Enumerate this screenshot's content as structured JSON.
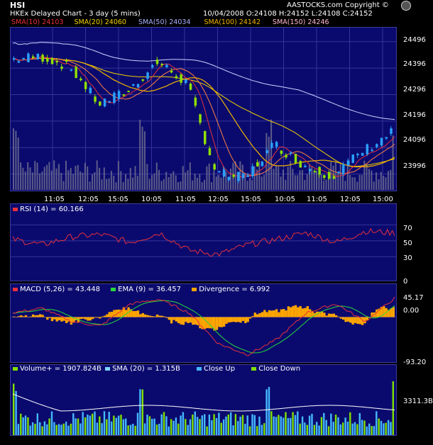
{
  "header": {
    "symbol": "HSI",
    "copyright": "AASTOCKS.com Copyright ©",
    "chart_label": "HKEx  Delayed Chart - 3 day (5 mins)",
    "ohlc": "10/04/2008  O:24108  H:24152  L:24108  C:24152"
  },
  "sma_legend": [
    {
      "text": "SMA(10) 24103",
      "color": "#e8303a"
    },
    {
      "text": "SMA(20) 24060",
      "color": "#f2d000"
    },
    {
      "text": "SMA(50) 24034",
      "color": "#a8b0ff"
    },
    {
      "text": "SMA(100) 24142",
      "color": "#f2b400"
    },
    {
      "text": "SMA(150) 24246",
      "color": "#ffb8d0"
    }
  ],
  "price_axis": [
    "24496",
    "24396",
    "24296",
    "24196",
    "24096",
    "23996"
  ],
  "time_axis": [
    "11:05",
    "12:05",
    "15:05",
    "10:05",
    "11:05",
    "12:05",
    "15:05",
    "10:05",
    "11:05",
    "12:05",
    "15:00"
  ],
  "rsi": {
    "label": "RSI (14) = 60.166",
    "axis": [
      "70",
      "50",
      "30",
      "0"
    ]
  },
  "macd": {
    "legend": [
      {
        "text": "MACD (5,26) = 43.448",
        "color": "#e8303a"
      },
      {
        "text": "EMA (9) = 36.457",
        "color": "#2ad83a"
      },
      {
        "text": "Divergence = 6.992",
        "color": "#ffa500"
      }
    ],
    "axis": [
      "45.17",
      "0.00",
      "-93.20"
    ]
  },
  "volume": {
    "legend": [
      {
        "text": "Volume+ = 1907.824B",
        "color": "#7fe000"
      },
      {
        "text": "SMA (20) = 1.315B",
        "color": "#7fd7ff"
      },
      {
        "text": "Close Up",
        "color": "#44b8ff"
      },
      {
        "text": "Close Down",
        "color": "#7fe000"
      }
    ],
    "axis": [
      "3311.3B"
    ]
  },
  "colors": {
    "panel_bg": "#0a0a6e",
    "up": "#2aa0ff",
    "down": "#8fe000",
    "grid": "#3a3ab0"
  },
  "chart_data": {
    "type": "line",
    "title": "HSI",
    "x": [
      "11:05",
      "12:05",
      "15:05",
      "10:05",
      "11:05",
      "12:05",
      "15:05",
      "10:05",
      "11:05",
      "12:05",
      "15:00"
    ],
    "close": [
      24430,
      24440,
      24400,
      24260,
      24310,
      24420,
      24340,
      24000,
      23980,
      24110,
      24030,
      23990,
      24080,
      24152
    ],
    "ylim": [
      23936,
      24546
    ],
    "rsi_values": [
      52,
      45,
      55,
      58,
      48,
      60,
      38,
      33,
      45,
      52,
      60,
      48,
      62,
      60
    ],
    "macd_values": [
      10,
      20,
      -10,
      -20,
      30,
      40,
      10,
      -60,
      -85,
      -50,
      10,
      30,
      -10,
      43
    ]
  }
}
